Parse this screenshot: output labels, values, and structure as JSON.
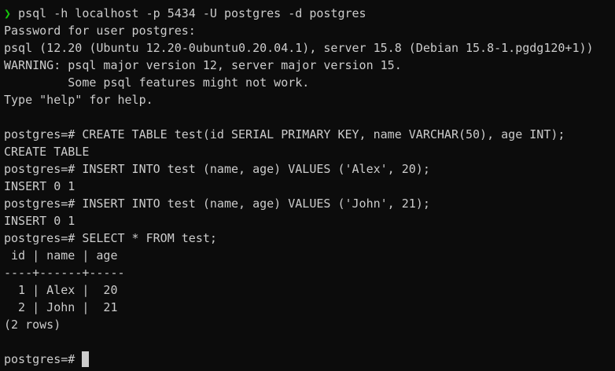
{
  "colors": {
    "background": "#0c0c0c",
    "foreground": "#cccccc",
    "prompt_arrow": "#16c60c"
  },
  "terminal": {
    "shell_prompt_icon": "chevron-right-icon",
    "shell_prompt_glyph": "❯",
    "shell_command": " psql -h localhost -p 5434 -U postgres -d postgres",
    "lines": [
      "Password for user postgres:",
      "psql (12.20 (Ubuntu 12.20-0ubuntu0.20.04.1), server 15.8 (Debian 15.8-1.pgdg120+1))",
      "WARNING: psql major version 12, server major version 15.",
      "         Some psql features might not work.",
      "Type \"help\" for help.",
      "",
      "postgres=# CREATE TABLE test(id SERIAL PRIMARY KEY, name VARCHAR(50), age INT);",
      "CREATE TABLE",
      "postgres=# INSERT INTO test (name, age) VALUES ('Alex', 20);",
      "INSERT 0 1",
      "postgres=# INSERT INTO test (name, age) VALUES ('John', 21);",
      "INSERT 0 1",
      "postgres=# SELECT * FROM test;",
      " id | name | age ",
      "----+------+-----",
      "  1 | Alex |  20",
      "  2 | John |  21",
      "(2 rows)",
      ""
    ],
    "current_prompt": "postgres=# "
  }
}
